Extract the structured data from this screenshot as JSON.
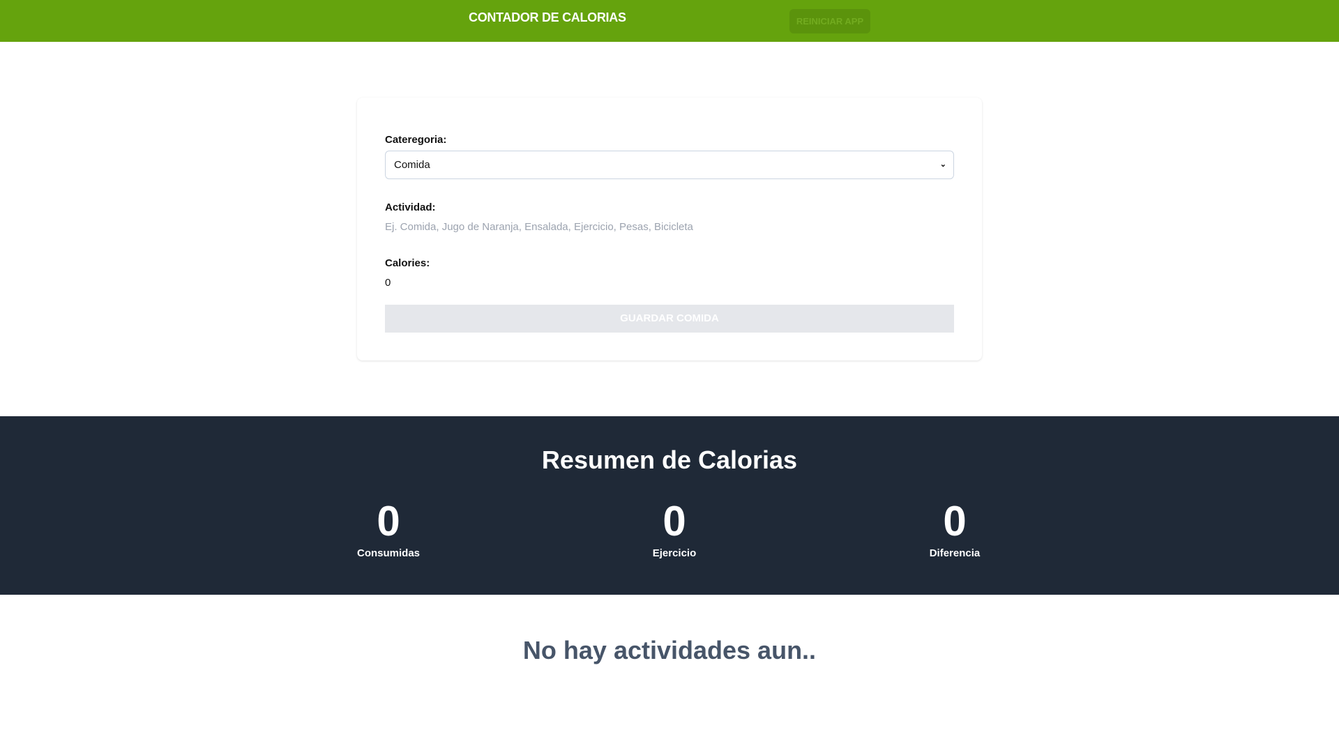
{
  "header": {
    "title": "CONTADOR DE CALORIAS",
    "reset_label": "REINICIAR APP"
  },
  "form": {
    "category_label": "Cateregoria:",
    "category_value": "Comida",
    "activity_label": "Actividad:",
    "activity_placeholder": "Ej. Comida, Jugo de Naranja, Ensalada, Ejercicio, Pesas, Bicicleta",
    "calories_label": "Calories:",
    "calories_value": "0",
    "submit_label": "GUARDAR COMIDA"
  },
  "summary": {
    "title": "Resumen de Calorias",
    "stats": [
      {
        "value": "0",
        "label": "Consumidas"
      },
      {
        "value": "0",
        "label": "Ejercicio"
      },
      {
        "value": "0",
        "label": "Diferencia"
      }
    ]
  },
  "activities": {
    "empty_message": "No hay actividades aun.."
  },
  "colors": {
    "brand": "#65a30d",
    "summary_bg": "#1f2937"
  }
}
